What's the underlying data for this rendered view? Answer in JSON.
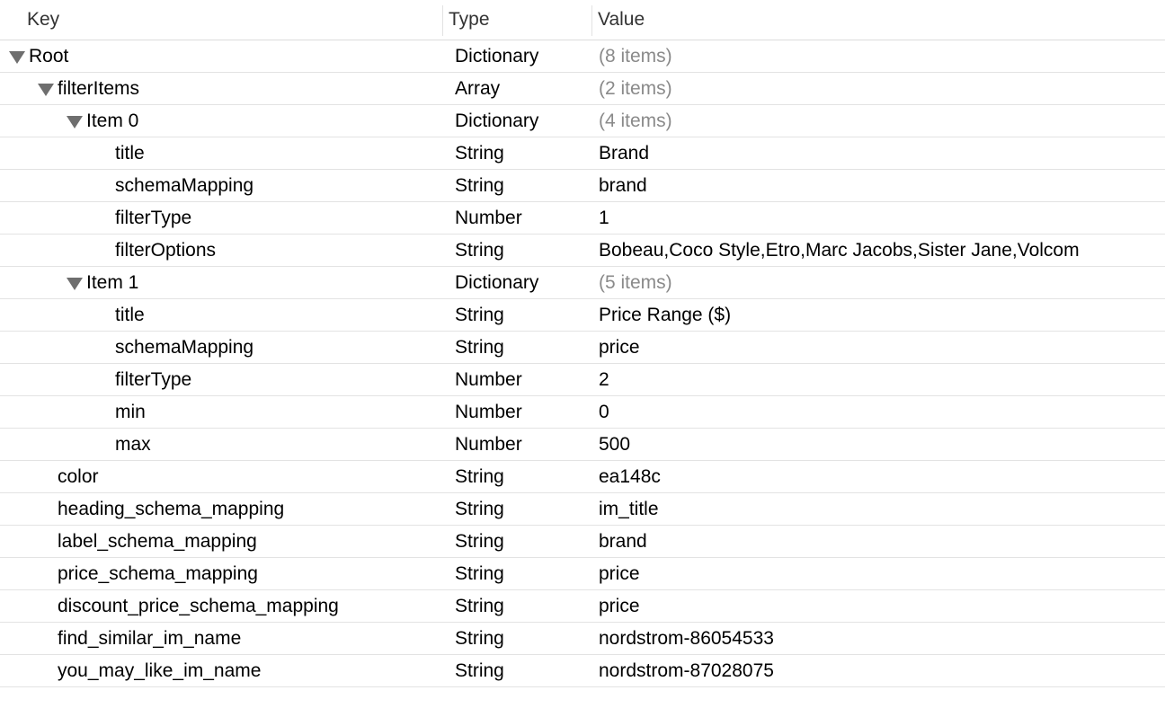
{
  "columns": {
    "key": "Key",
    "type": "Type",
    "value": "Value"
  },
  "rows": [
    {
      "key": "Root",
      "type": "Dictionary",
      "value": "(8 items)",
      "depth": 0,
      "expandable": true,
      "muted": true
    },
    {
      "key": "filterItems",
      "type": "Array",
      "value": "(2 items)",
      "depth": 1,
      "expandable": true,
      "muted": true
    },
    {
      "key": "Item 0",
      "type": "Dictionary",
      "value": "(4 items)",
      "depth": 2,
      "expandable": true,
      "muted": true
    },
    {
      "key": "title",
      "type": "String",
      "value": "Brand",
      "depth": 3,
      "expandable": false,
      "muted": false
    },
    {
      "key": "schemaMapping",
      "type": "String",
      "value": "brand",
      "depth": 3,
      "expandable": false,
      "muted": false
    },
    {
      "key": "filterType",
      "type": "Number",
      "value": "1",
      "depth": 3,
      "expandable": false,
      "muted": false
    },
    {
      "key": "filterOptions",
      "type": "String",
      "value": "Bobeau,Coco Style,Etro,Marc Jacobs,Sister Jane,Volcom",
      "depth": 3,
      "expandable": false,
      "muted": false
    },
    {
      "key": "Item 1",
      "type": "Dictionary",
      "value": "(5 items)",
      "depth": 2,
      "expandable": true,
      "muted": true
    },
    {
      "key": "title",
      "type": "String",
      "value": "Price Range ($)",
      "depth": 3,
      "expandable": false,
      "muted": false
    },
    {
      "key": "schemaMapping",
      "type": "String",
      "value": "price",
      "depth": 3,
      "expandable": false,
      "muted": false
    },
    {
      "key": "filterType",
      "type": "Number",
      "value": "2",
      "depth": 3,
      "expandable": false,
      "muted": false
    },
    {
      "key": "min",
      "type": "Number",
      "value": "0",
      "depth": 3,
      "expandable": false,
      "muted": false
    },
    {
      "key": "max",
      "type": "Number",
      "value": "500",
      "depth": 3,
      "expandable": false,
      "muted": false
    },
    {
      "key": "color",
      "type": "String",
      "value": "ea148c",
      "depth": 1,
      "expandable": false,
      "muted": false
    },
    {
      "key": "heading_schema_mapping",
      "type": "String",
      "value": "im_title",
      "depth": 1,
      "expandable": false,
      "muted": false
    },
    {
      "key": "label_schema_mapping",
      "type": "String",
      "value": "brand",
      "depth": 1,
      "expandable": false,
      "muted": false
    },
    {
      "key": "price_schema_mapping",
      "type": "String",
      "value": "price",
      "depth": 1,
      "expandable": false,
      "muted": false
    },
    {
      "key": "discount_price_schema_mapping",
      "type": "String",
      "value": "price",
      "depth": 1,
      "expandable": false,
      "muted": false
    },
    {
      "key": "find_similar_im_name",
      "type": "String",
      "value": "nordstrom-86054533",
      "depth": 1,
      "expandable": false,
      "muted": false
    },
    {
      "key": "you_may_like_im_name",
      "type": "String",
      "value": "nordstrom-87028075",
      "depth": 1,
      "expandable": false,
      "muted": false
    }
  ]
}
